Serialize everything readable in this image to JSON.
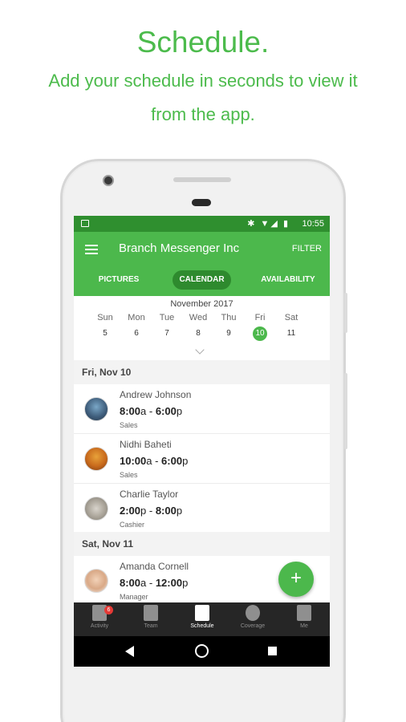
{
  "promo": {
    "title": "Schedule.",
    "subtitle_line1": "Add your schedule in seconds to view it",
    "subtitle_line2": "from the app."
  },
  "statusbar": {
    "time": "10:55",
    "icons": "✱ ▼◢ ▮"
  },
  "appbar": {
    "title": "Branch Messenger Inc",
    "filter": "FILTER"
  },
  "tabs": {
    "pictures": "PICTURES",
    "calendar": "CALENDAR",
    "availability": "AVAILABILITY"
  },
  "calendar": {
    "month": "November 2017",
    "days": [
      {
        "name": "Sun",
        "num": "5"
      },
      {
        "name": "Mon",
        "num": "6"
      },
      {
        "name": "Tue",
        "num": "7"
      },
      {
        "name": "Wed",
        "num": "8"
      },
      {
        "name": "Thu",
        "num": "9"
      },
      {
        "name": "Fri",
        "num": "10"
      },
      {
        "name": "Sat",
        "num": "11"
      }
    ],
    "selected_day": "10"
  },
  "sections": [
    {
      "header": "Fri, Nov 10",
      "shifts": [
        {
          "name": "Andrew Johnson",
          "start": "8:00",
          "start_suffix": "a",
          "end": "6:00",
          "end_suffix": "p",
          "role": "Sales"
        },
        {
          "name": "Nidhi Baheti",
          "start": "10:00",
          "start_suffix": "a",
          "end": "6:00",
          "end_suffix": "p",
          "role": "Sales"
        },
        {
          "name": "Charlie Taylor",
          "start": "2:00",
          "start_suffix": "p",
          "end": "8:00",
          "end_suffix": "p",
          "role": "Cashier"
        }
      ]
    },
    {
      "header": "Sat, Nov 11",
      "shifts": [
        {
          "name": "Amanda Cornell",
          "start": "8:00",
          "start_suffix": "a",
          "end": "12:00",
          "end_suffix": "p",
          "role": "Manager"
        }
      ]
    }
  ],
  "time_separator": " - ",
  "fab": "+",
  "bottomnav": {
    "activity": "Activity",
    "activity_badge": "6",
    "team": "Team",
    "schedule": "Schedule",
    "coverage": "Coverage",
    "me": "Me"
  },
  "colors": {
    "brand_green": "#4cb84c",
    "dark_green": "#2e8a2e",
    "promo_green": "#4cbb4c",
    "badge_red": "#e53935"
  }
}
